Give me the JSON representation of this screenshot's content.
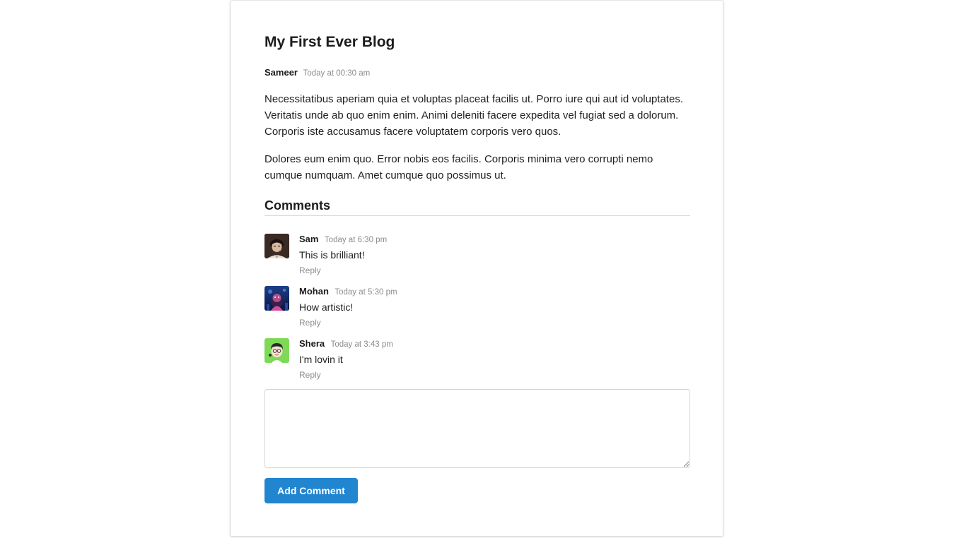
{
  "post": {
    "title": "My First Ever Blog",
    "author": "Sameer",
    "time": "Today at 00:30 am",
    "paragraphs": [
      "Necessitatibus aperiam quia et voluptas placeat facilis ut. Porro iure qui aut id voluptates. Veritatis unde ab quo enim enim. Animi deleniti facere expedita vel fugiat sed a dolorum. Corporis iste accusamus facere voluptatem corporis vero quos.",
      "Dolores eum enim quo. Error nobis eos facilis. Corporis minima vero corrupti nemo cumque numquam. Amet cumque quo possimus ut."
    ]
  },
  "comments_section": {
    "header": "Comments",
    "items": [
      {
        "author": "Sam",
        "time": "Today at 6:30 pm",
        "text": "This is brilliant!",
        "reply_label": "Reply"
      },
      {
        "author": "Mohan",
        "time": "Today at 5:30 pm",
        "text": "How artistic!",
        "reply_label": "Reply"
      },
      {
        "author": "Shera",
        "time": "Today at 3:43 pm",
        "text": "I'm lovin it",
        "reply_label": "Reply"
      }
    ]
  },
  "form": {
    "textarea_value": "",
    "submit_label": "Add Comment"
  },
  "colors": {
    "accent": "#2185d0",
    "muted_text": "#8c8c8c"
  }
}
